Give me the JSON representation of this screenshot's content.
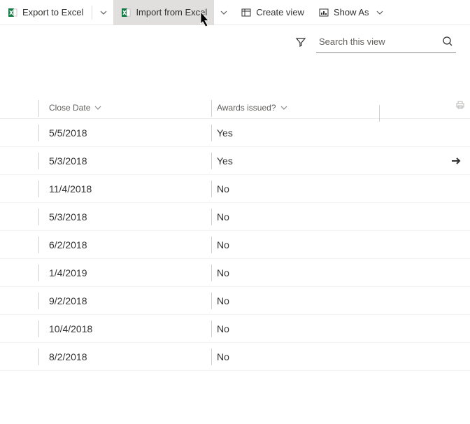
{
  "toolbar": {
    "export_label": "Export to Excel",
    "import_label": "Import from Excel",
    "create_view_label": "Create view",
    "show_as_label": "Show As"
  },
  "search": {
    "placeholder": "Search this view"
  },
  "columns": {
    "close_date": "Close Date",
    "awards_issued": "Awards issued?"
  },
  "rows": [
    {
      "date": "5/5/2018",
      "awards": "Yes",
      "arrow": false
    },
    {
      "date": "5/3/2018",
      "awards": "Yes",
      "arrow": true
    },
    {
      "date": "11/4/2018",
      "awards": "No",
      "arrow": false
    },
    {
      "date": "5/3/2018",
      "awards": "No",
      "arrow": false
    },
    {
      "date": "6/2/2018",
      "awards": "No",
      "arrow": false
    },
    {
      "date": "1/4/2019",
      "awards": "No",
      "arrow": false
    },
    {
      "date": "9/2/2018",
      "awards": "No",
      "arrow": false
    },
    {
      "date": "10/4/2018",
      "awards": "No",
      "arrow": false
    },
    {
      "date": "8/2/2018",
      "awards": "No",
      "arrow": false
    }
  ]
}
